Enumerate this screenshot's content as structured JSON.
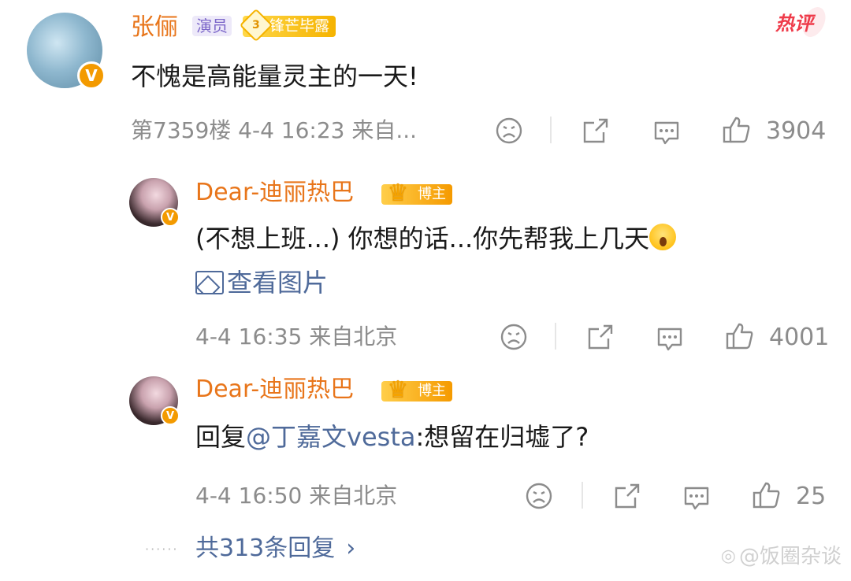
{
  "hot_label": "热评",
  "main_comment": {
    "name": "张俪",
    "role_badge": "演员",
    "level_number": "3",
    "level_badge": "锋芒毕露",
    "verified_mark": "V",
    "text": "不愧是高能量灵主的一天!",
    "meta": "第7359楼 4-4 16:23 来自...",
    "likes": "3904"
  },
  "replies": [
    {
      "name": "Dear-迪丽热巴",
      "badge": "博主",
      "verified_mark": "V",
      "text": "(不想上班...) 你想的话...你先帮我上几天",
      "view_image": "查看图片",
      "meta": "4-4 16:35 来自北京",
      "likes": "4001"
    },
    {
      "name": "Dear-迪丽热巴",
      "badge": "博主",
      "verified_mark": "V",
      "text_prefix": "回复",
      "mention": "@丁嘉文vesta",
      "text": ":想留在归墟了?",
      "meta": "4-4 16:50 来自北京",
      "likes": "25"
    }
  ],
  "total_replies": "共313条回复",
  "watermark": "@饭圈杂谈"
}
